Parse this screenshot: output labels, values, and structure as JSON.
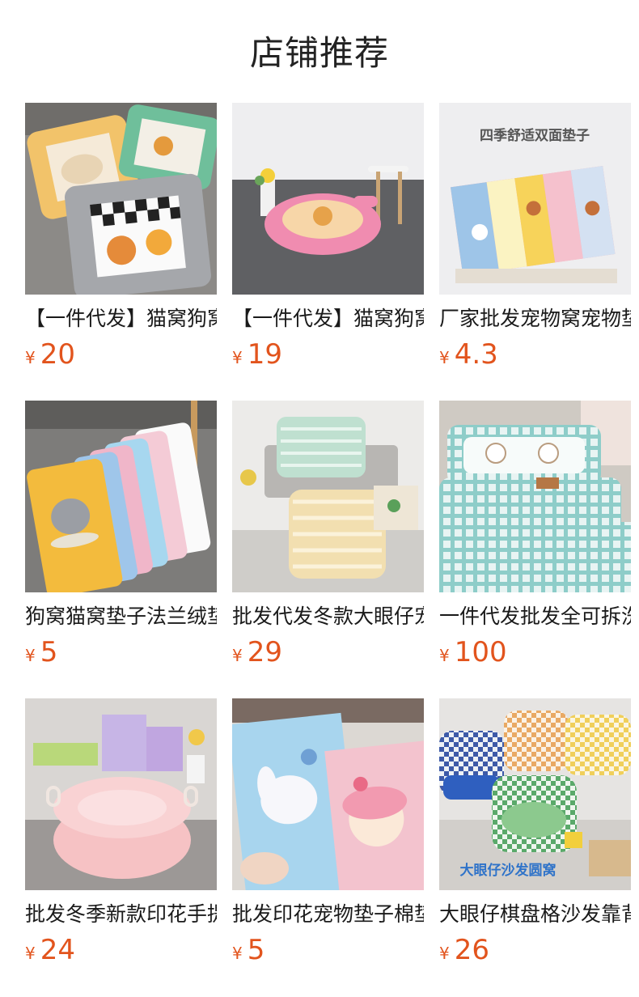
{
  "header": {
    "title": "店铺推荐"
  },
  "colors": {
    "price": "#e2541d",
    "title": "#222222"
  },
  "products": [
    {
      "name": "【一件代发】猫窝狗窝",
      "currency": "¥",
      "price": "20",
      "image": "square-pet-beds-image"
    },
    {
      "name": "【一件代发】猫窝狗窝",
      "currency": "¥",
      "price": "19",
      "image": "pink-round-pet-bed-image"
    },
    {
      "name": "厂家批发宠物窝宠物垫",
      "currency": "¥",
      "price": "4.3",
      "image": "pet-mats-stack-image",
      "image_text": "四季舒适双面垫子"
    },
    {
      "name": "狗窝猫窝垫子法兰绒垫",
      "currency": "¥",
      "price": "5",
      "image": "flannel-pet-mats-image"
    },
    {
      "name": "批发代发冬款大眼仔宠",
      "currency": "¥",
      "price": "29",
      "image": "striped-pet-beds-image"
    },
    {
      "name": "一件代发批发全可拆洗",
      "currency": "¥",
      "price": "100",
      "image": "plaid-pet-beds-image"
    },
    {
      "name": "批发冬季新款印花手提",
      "currency": "¥",
      "price": "24",
      "image": "pink-basket-bed-image"
    },
    {
      "name": "批发印花宠物垫子棉垫",
      "currency": "¥",
      "price": "5",
      "image": "printed-pet-mat-image"
    },
    {
      "name": "大眼仔棋盘格沙发靠背",
      "currency": "¥",
      "price": "26",
      "image": "checker-sofa-beds-image",
      "image_text": "大眼仔沙发圆窝"
    }
  ]
}
